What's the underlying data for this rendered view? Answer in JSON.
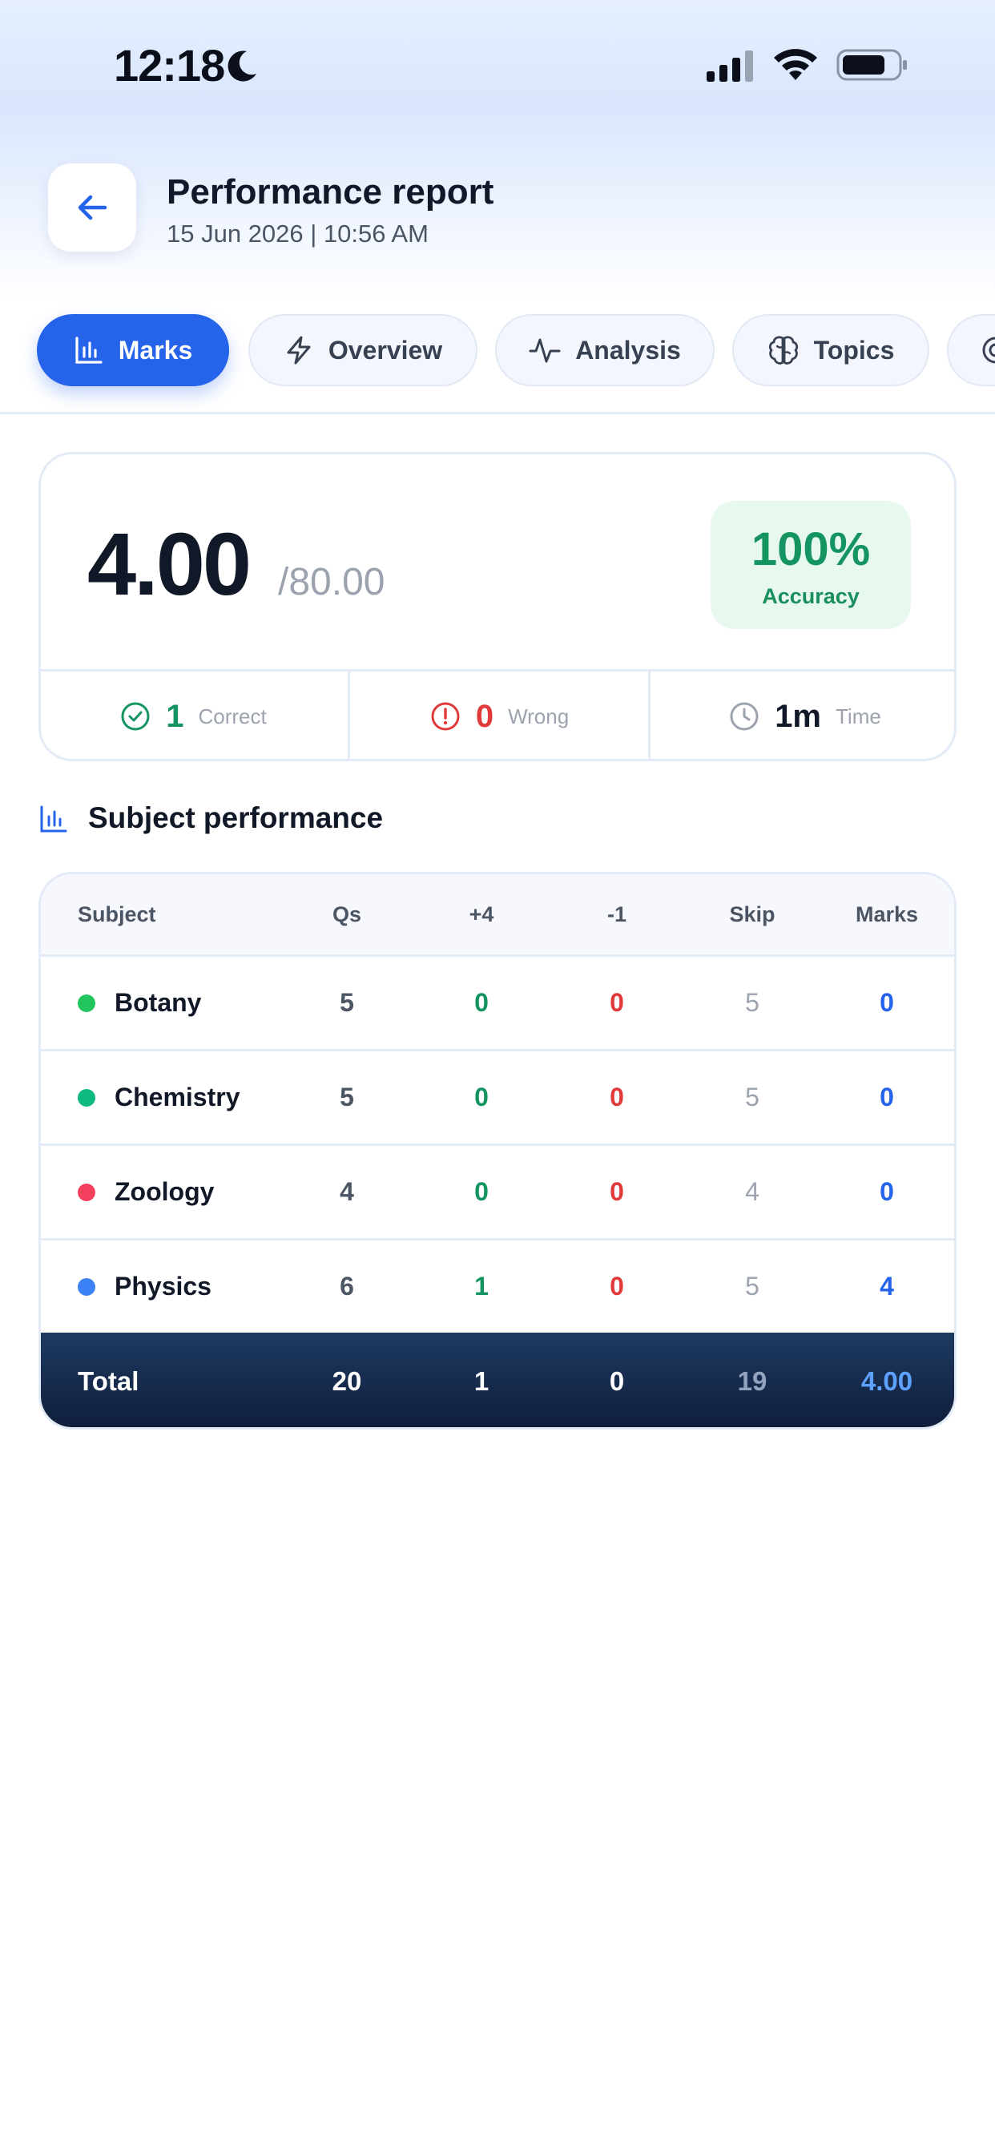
{
  "status_bar": {
    "time": "12:18"
  },
  "header": {
    "title": "Performance report",
    "subtitle": "15 Jun 2026 | 10:56 AM"
  },
  "tabs": [
    {
      "label": "Marks",
      "icon": "bar-chart-icon",
      "active": true
    },
    {
      "label": "Overview",
      "icon": "lightning-icon",
      "active": false
    },
    {
      "label": "Analysis",
      "icon": "pulse-icon",
      "active": false
    },
    {
      "label": "Topics",
      "icon": "brain-icon",
      "active": false
    }
  ],
  "score": {
    "value": "4.00",
    "total": "/80.00",
    "accuracy_value": "100%",
    "accuracy_label": "Accuracy"
  },
  "stats": {
    "correct_value": "1",
    "correct_label": "Correct",
    "wrong_value": "0",
    "wrong_label": "Wrong",
    "time_value": "1m",
    "time_label": "Time"
  },
  "section": {
    "title": "Subject performance"
  },
  "table": {
    "headers": {
      "subject": "Subject",
      "qs": "Qs",
      "plus": "+4",
      "minus": "-1",
      "skip": "Skip",
      "marks": "Marks"
    },
    "rows": [
      {
        "subject": "Botany",
        "qs": "5",
        "plus": "0",
        "minus": "0",
        "skip": "5",
        "marks": "0",
        "color": "#22c55e"
      },
      {
        "subject": "Chemistry",
        "qs": "5",
        "plus": "0",
        "minus": "0",
        "skip": "5",
        "marks": "0",
        "color": "#10b981"
      },
      {
        "subject": "Zoology",
        "qs": "4",
        "plus": "0",
        "minus": "0",
        "skip": "4",
        "marks": "0",
        "color": "#f43f5e"
      },
      {
        "subject": "Physics",
        "qs": "6",
        "plus": "1",
        "minus": "0",
        "skip": "5",
        "marks": "4",
        "color": "#3b82f6"
      }
    ],
    "total": {
      "label": "Total",
      "qs": "20",
      "plus": "1",
      "minus": "0",
      "skip": "19",
      "marks": "4.00"
    }
  },
  "colors": {
    "accent": "#2563eb",
    "success": "#149460",
    "danger": "#e03a3a",
    "total_row": "#14243f"
  }
}
